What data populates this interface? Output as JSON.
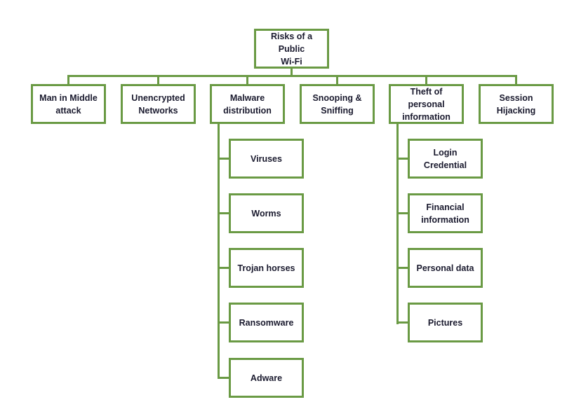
{
  "diagram": {
    "type": "hierarchy",
    "line_color": "#6a9a44",
    "root": "Risks of a Public\nWi-Fi",
    "level1": [
      {
        "label": "Man in Middle\nattack",
        "children": []
      },
      {
        "label": "Unencrypted\nNetworks",
        "children": []
      },
      {
        "label": "Malware\ndistribution",
        "children": [
          "Viruses",
          "Worms",
          "Trojan horses",
          "Ransomware",
          "Adware"
        ]
      },
      {
        "label": "Snooping &\nSniffing",
        "children": []
      },
      {
        "label": "Theft of personal\ninformation",
        "children": [
          "Login Credential",
          "Financial\ninformation",
          "Personal data",
          "Pictures"
        ]
      },
      {
        "label": "Session Hijacking",
        "children": []
      }
    ]
  }
}
